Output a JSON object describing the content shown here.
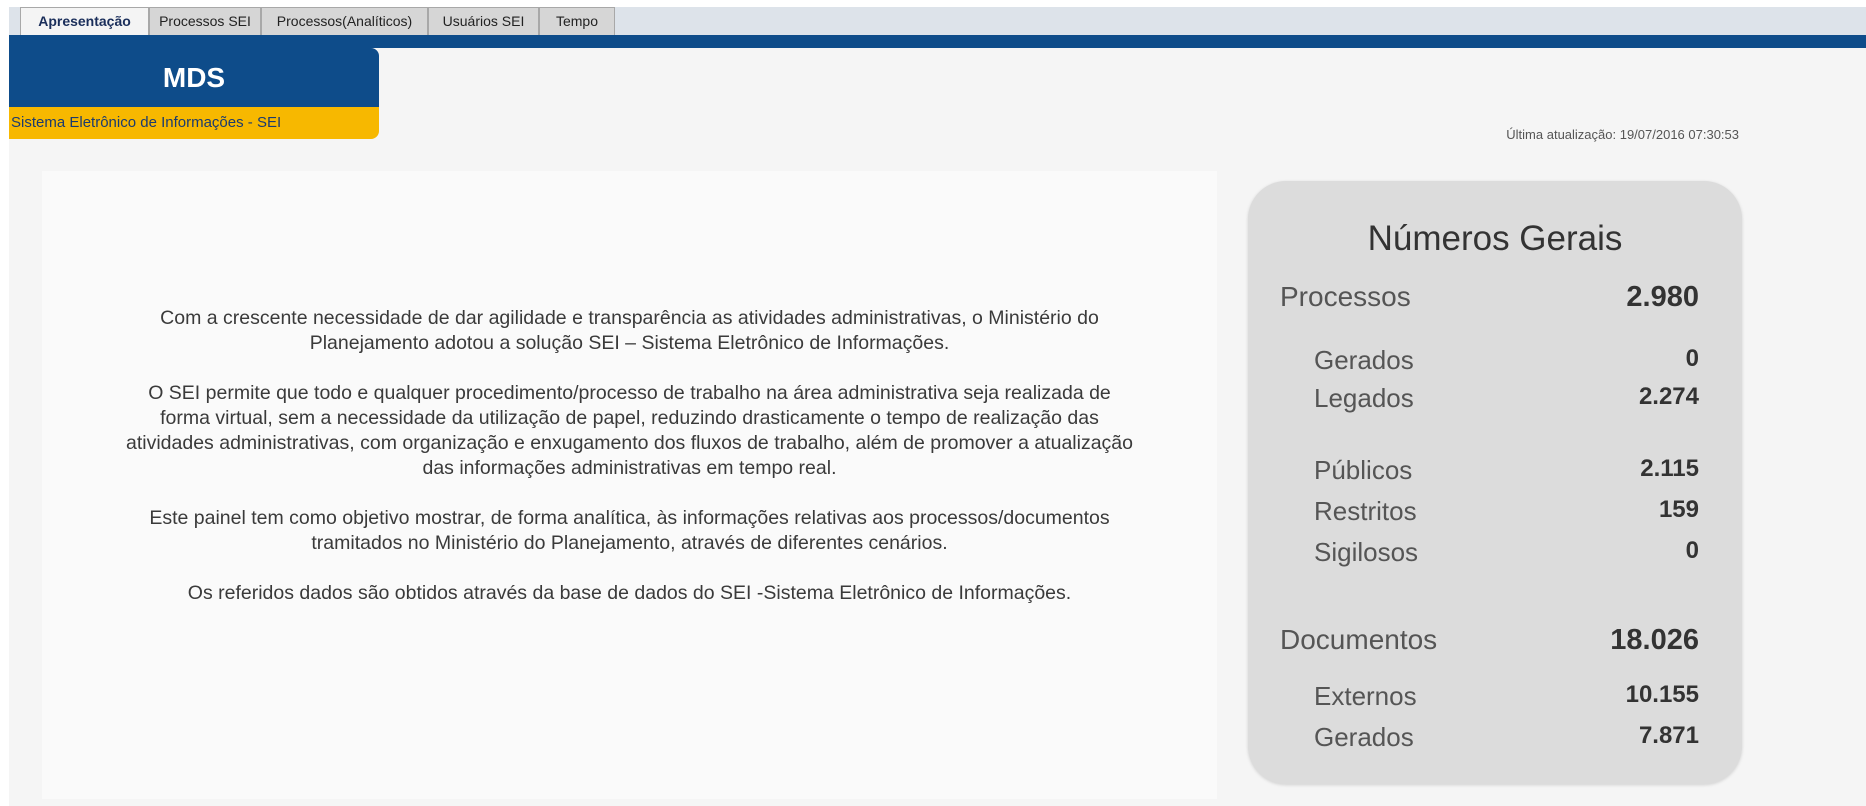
{
  "tabs": [
    {
      "label": "Apresentação"
    },
    {
      "label": "Processos SEI"
    },
    {
      "label": "Processos(Analíticos)"
    },
    {
      "label": "Usuários SEI"
    },
    {
      "label": "Tempo"
    }
  ],
  "header": {
    "brand": "MDS",
    "system_name": "Sistema Eletrônico de Informações - SEI",
    "last_update": "Última atualização: 19/07/2016 07:30:53"
  },
  "intro": {
    "paragraphs": [
      {
        "lines": [
          "Com a crescente necessidade de dar agilidade e transparência as atividades administrativas, o Ministério do",
          "Planejamento adotou a solução SEI – Sistema Eletrônico de Informações."
        ]
      },
      {
        "lines": [
          "O SEI permite que todo e qualquer procedimento/processo de trabalho na área administrativa seja realizada de",
          "forma virtual, sem a necessidade da utilização de papel, reduzindo drasticamente o tempo de realização das",
          "atividades administrativas, com organização e enxugamento dos fluxos de trabalho, além de promover a atualização",
          "das informações administrativas em tempo real."
        ]
      },
      {
        "lines": [
          "Este painel tem como objetivo mostrar, de forma analítica, às informações relativas aos processos/documentos",
          "tramitados no Ministério do Planejamento, através de diferentes cenários."
        ]
      },
      {
        "lines": [
          "Os referidos dados são obtidos através da base de dados do SEI -Sistema Eletrônico de Informações."
        ]
      }
    ]
  },
  "stats": {
    "title": "Números Gerais",
    "processos": {
      "label": "Processos",
      "value": "2.980",
      "gerados": {
        "label": "Gerados",
        "value": "0"
      },
      "legados": {
        "label": "Legados",
        "value": "2.274"
      },
      "publicos": {
        "label": "Públicos",
        "value": "2.115"
      },
      "restritos": {
        "label": "Restritos",
        "value": "159"
      },
      "sigilosos": {
        "label": "Sigilosos",
        "value": "0"
      }
    },
    "documentos": {
      "label": "Documentos",
      "value": "18.026",
      "externos": {
        "label": "Externos",
        "value": "10.155"
      },
      "gerados": {
        "label": "Gerados",
        "value": "7.871"
      }
    }
  }
}
